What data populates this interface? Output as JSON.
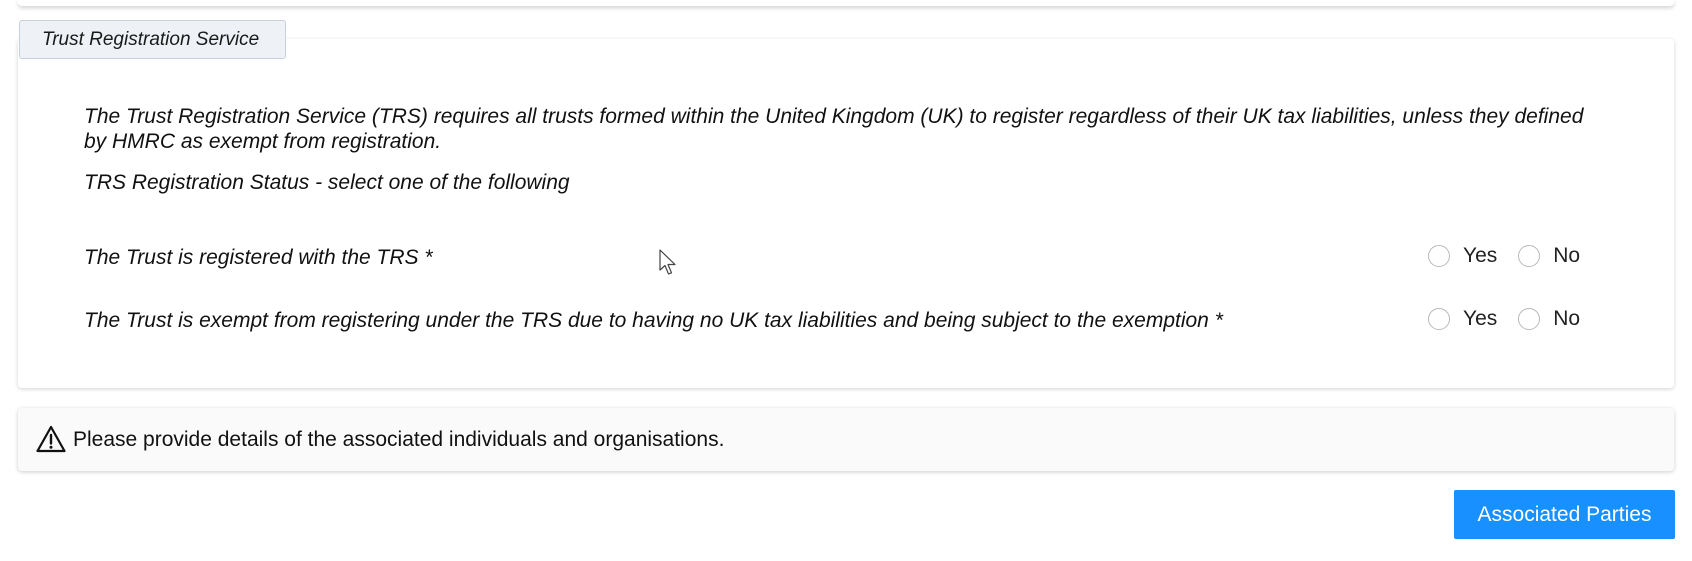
{
  "section": {
    "tab_label": "Trust Registration Service",
    "intro": "The Trust Registration Service (TRS) requires all trusts formed within the United Kingdom (UK) to register regardless of their UK tax liabilities, unless they defined by HMRC as exempt from registration.",
    "status_heading": "TRS Registration Status - select one of the following",
    "questions": [
      {
        "label": "The Trust is registered with the TRS *",
        "options": [
          "Yes",
          "No"
        ],
        "selected": null
      },
      {
        "label": "The Trust is exempt from registering under the TRS due to having no UK tax liabilities and being subject to the exemption *",
        "options": [
          "Yes",
          "No"
        ],
        "selected": null
      }
    ]
  },
  "notice": {
    "icon": "warning-icon",
    "text": "Please provide details of the associated individuals and organisations."
  },
  "actions": {
    "associated_parties_label": "Associated Parties"
  },
  "colors": {
    "primary": "#1890ff",
    "tab_background": "#eef2f6",
    "notice_background": "#fafafa"
  }
}
